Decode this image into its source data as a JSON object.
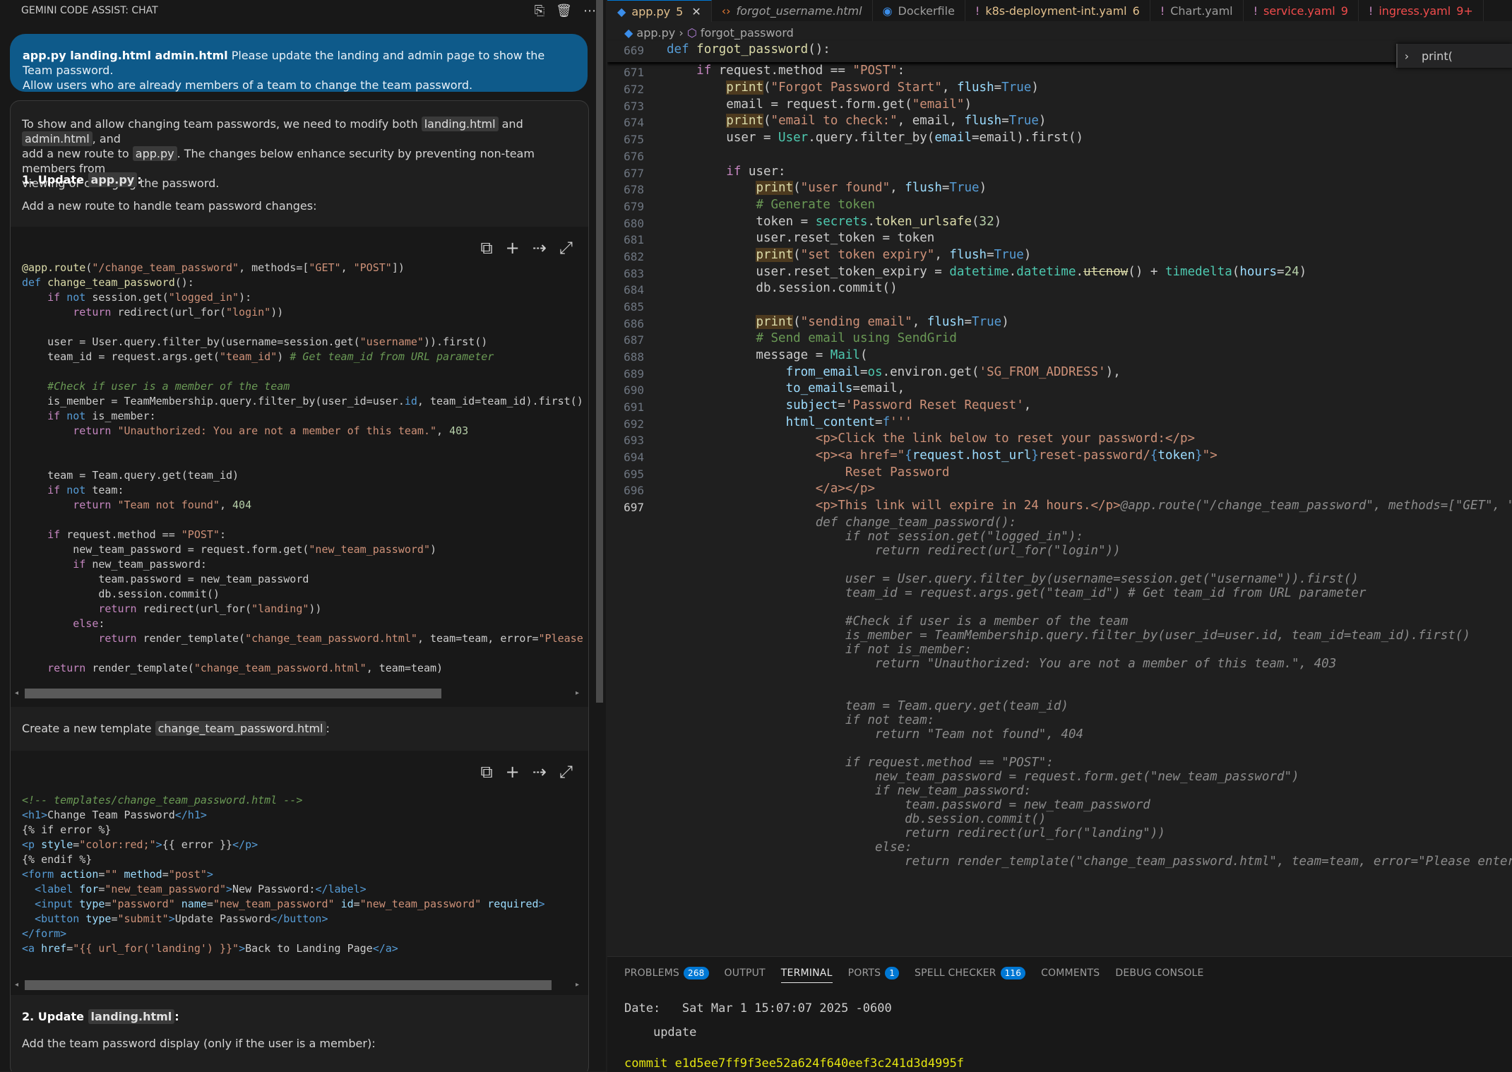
{
  "chat": {
    "header_title": "GEMINI CODE ASSIST: CHAT",
    "header_icons": [
      "history-icon",
      "trash-icon",
      "more-icon"
    ],
    "user_message": {
      "files": "app.py landing.html admin.html",
      "text_line1": " Please update the landing and admin page to show the Team password.",
      "text_line2": "Allow users who are already members of a team to change the team password."
    },
    "response": {
      "intro_1": "To show and allow changing team passwords, we need to modify both ",
      "intro_chip1": "landing.html",
      "intro_and": " and ",
      "intro_chip2": "admin.html",
      "intro_2": ", and",
      "intro_3": "add a new route to ",
      "intro_chip3": "app.py",
      "intro_4": ". The changes below enhance security by preventing non-team members from",
      "intro_5": "viewing or changing the password.",
      "step1_prefix": "1. Update ",
      "step1_chip": "app.py",
      "step1_suffix": ":",
      "step1_desc": "Add a new route to handle team password changes:",
      "create_prefix": "Create a new template ",
      "create_chip": "change_team_password.html",
      "create_suffix": ":",
      "step2_prefix": "2. Update ",
      "step2_chip": "landing.html",
      "step2_suffix": ":",
      "step2_desc": "Add the team password display (only if the user is a member):"
    },
    "code_tools": [
      "copy-icon",
      "insert-icon",
      "diff-icon",
      "expand-icon"
    ]
  },
  "editor": {
    "tabs": [
      {
        "label": "app.py",
        "badge": "5",
        "active": true,
        "color": "#e2c08d",
        "icon": "python-icon"
      },
      {
        "label": "forgot_username.html",
        "badge": "",
        "active": false,
        "color": "#9d9d9d",
        "icon": "html-icon"
      },
      {
        "label": "Dockerfile",
        "badge": "",
        "active": false,
        "color": "#9d9d9d",
        "icon": "docker-icon"
      },
      {
        "label": "k8s-deployment-int.yaml",
        "badge": "6",
        "active": false,
        "color": "#e2c08d",
        "icon": "yaml-icon"
      },
      {
        "label": "Chart.yaml",
        "badge": "",
        "active": false,
        "color": "#9d9d9d",
        "icon": "yaml-icon"
      },
      {
        "label": "service.yaml",
        "badge": "9",
        "active": false,
        "color": "#f14c4c",
        "icon": "yaml-icon"
      },
      {
        "label": "ingress.yaml",
        "badge": "9+",
        "active": false,
        "color": "#f14c4c",
        "icon": "yaml-icon"
      }
    ],
    "breadcrumb_file": "app.py",
    "breadcrumb_symbol": "forgot_password",
    "sticky_line_no": "669",
    "find_query": "print(",
    "line_numbers": [
      "671",
      "672",
      "673",
      "674",
      "675",
      "676",
      "677",
      "678",
      "679",
      "680",
      "681",
      "682",
      "683",
      "684",
      "685",
      "686",
      "687",
      "688",
      "689",
      "690",
      "691",
      "692",
      "693",
      "694",
      "695",
      "696",
      "697"
    ]
  },
  "panel": {
    "tabs": [
      {
        "label": "PROBLEMS",
        "badge": "268"
      },
      {
        "label": "OUTPUT",
        "badge": ""
      },
      {
        "label": "TERMINAL",
        "badge": "",
        "active": true
      },
      {
        "label": "PORTS",
        "badge": "1"
      },
      {
        "label": "SPELL CHECKER",
        "badge": "116"
      },
      {
        "label": "COMMENTS",
        "badge": ""
      },
      {
        "label": "DEBUG CONSOLE",
        "badge": ""
      }
    ],
    "terminal": {
      "date_label": "Date:",
      "date_value": "Sat Mar 1 15:07:07 2025 -0600",
      "message": "update",
      "commit": "commit e1d5ee7ff9f3ee52a624f640eef3c241d3d4995f"
    }
  }
}
